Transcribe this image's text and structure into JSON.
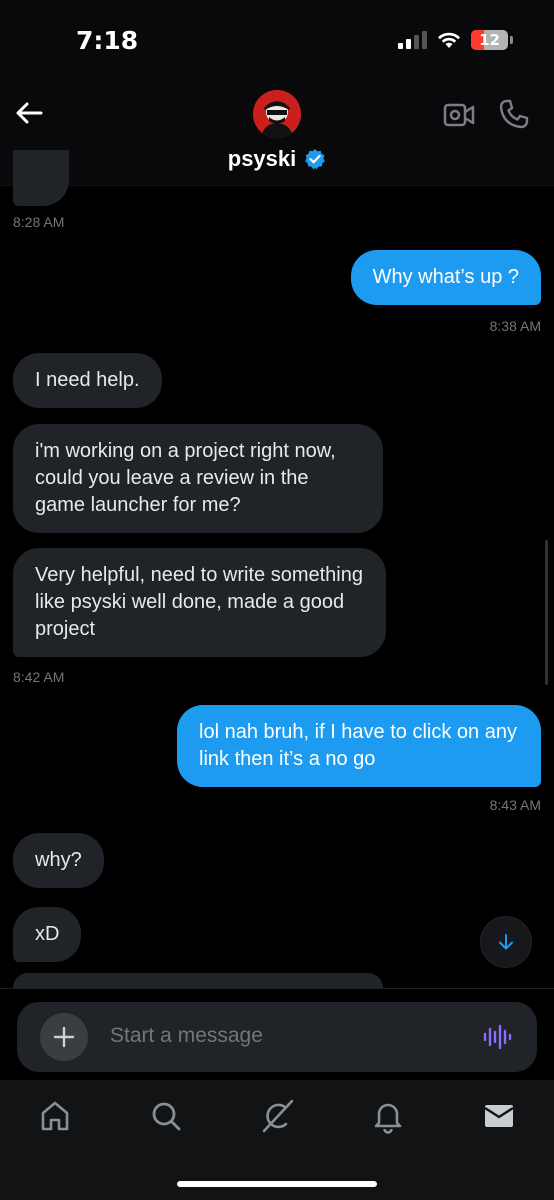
{
  "status_bar": {
    "time": "7:18",
    "battery": "12"
  },
  "header": {
    "title": "psyski",
    "verified": true
  },
  "messages": {
    "ts_1": "8:28 AM",
    "out_1": "Why what’s up ?",
    "ts_2": "8:38 AM",
    "in_1": "I need help.",
    "in_2": "i'm working on a project right now, could you leave a review in the game launcher for me?",
    "in_3": "Very helpful, need to write something like psyski well done, made a good project",
    "ts_3": "8:42 AM",
    "out_2": "lol nah bruh, if I have to click on any link then it’s a no go",
    "ts_4": "8:43 AM",
    "in_4": "why?",
    "in_5": "xD"
  },
  "composer": {
    "placeholder": "Start a message"
  },
  "tabs": [
    "home-icon",
    "search-icon",
    "grok-icon",
    "notifications-icon",
    "messages-icon"
  ],
  "colors": {
    "accent": "#1d9bf0",
    "incoming_bubble": "#202327",
    "voice_accent": "#8b6cff"
  }
}
